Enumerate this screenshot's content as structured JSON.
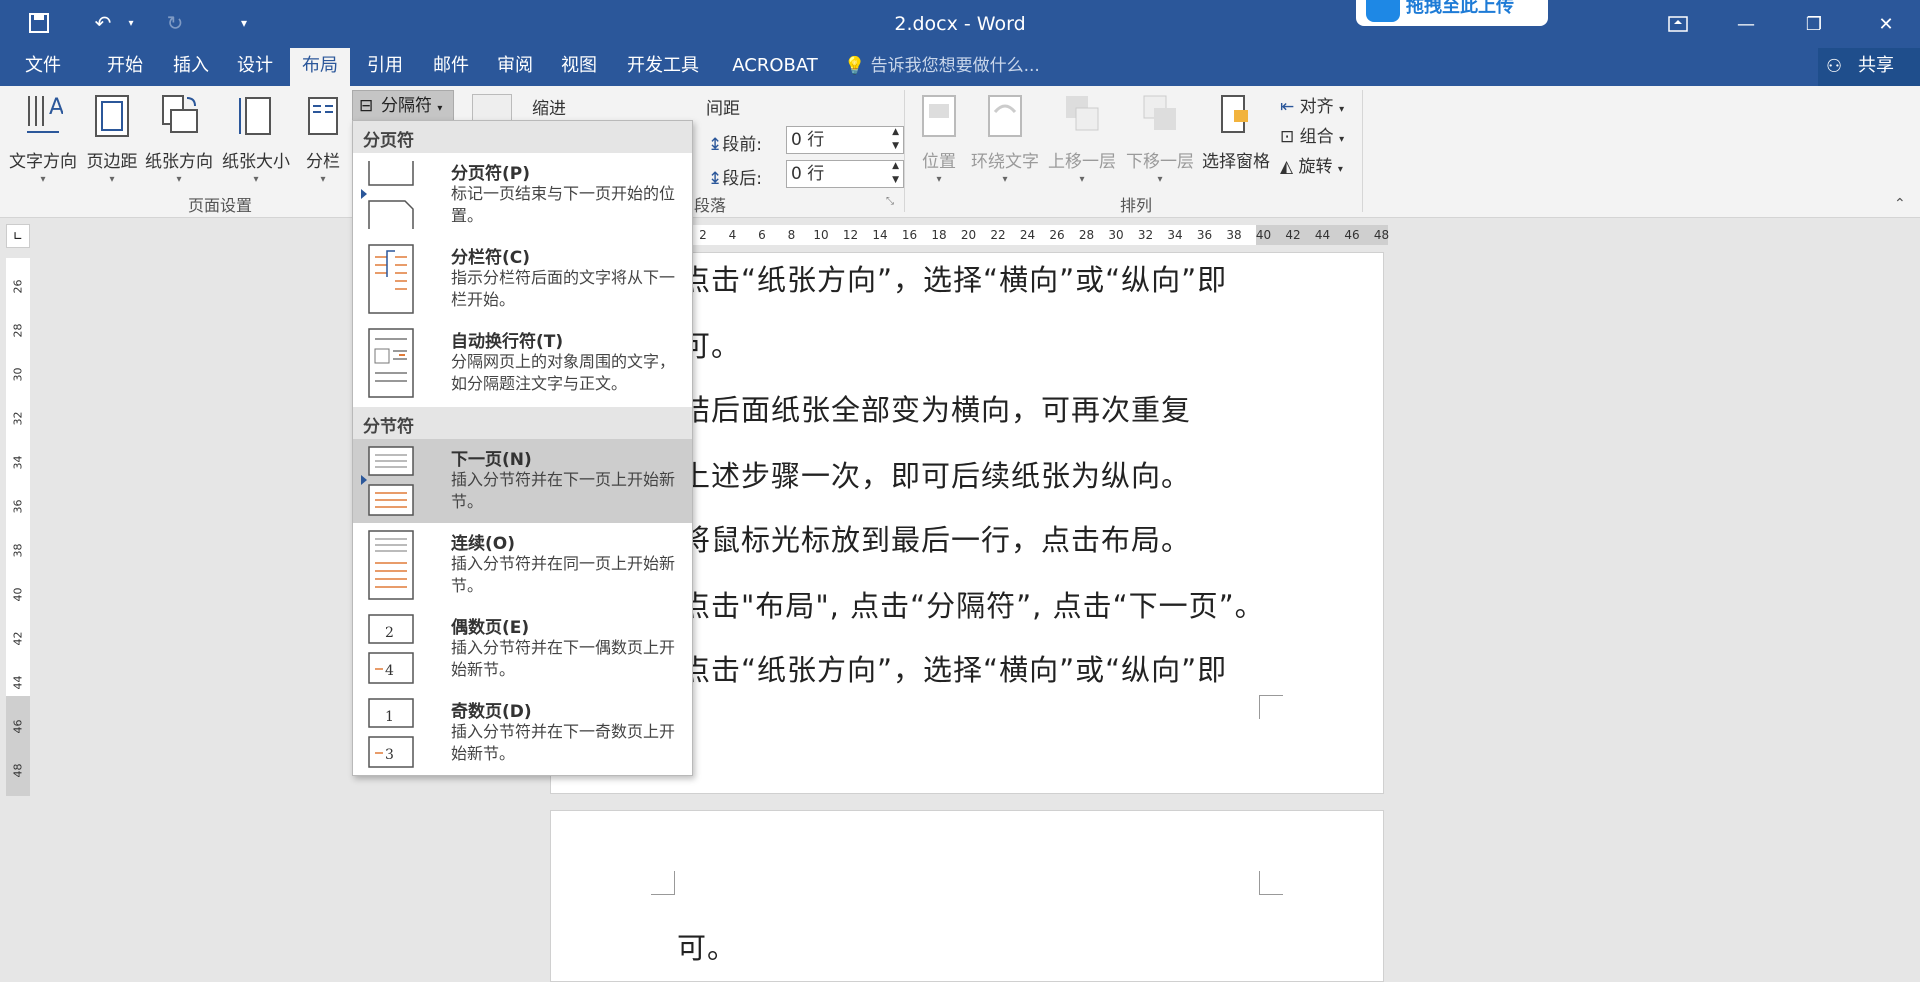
{
  "window": {
    "title": "2.docx - Word",
    "upload_badge": "拖拽至此上传"
  },
  "tabs": [
    "文件",
    "开始",
    "插入",
    "设计",
    "布局",
    "引用",
    "邮件",
    "审阅",
    "视图",
    "开发工具",
    "ACROBAT"
  ],
  "tell_me": "告诉我您想要做什么...",
  "share": "共享",
  "ribbon": {
    "page_setup": {
      "text_direction": "文字方向",
      "margins": "页边距",
      "orientation": "纸张方向",
      "size": "纸张大小",
      "columns": "分栏",
      "breaks": "分隔符",
      "group_label": "页面设置"
    },
    "paragraph": {
      "indent_label": "缩进",
      "spacing_label": "间距",
      "before_label": "段前:",
      "before_value": "0 行",
      "after_label": "段后:",
      "after_value": "0 行",
      "group_label": "段落"
    },
    "arrange": {
      "position": "位置",
      "wrap_text": "环绕文字",
      "bring_forward": "上移一层",
      "send_backward": "下移一层",
      "selection_pane": "选择窗格",
      "align": "对齐",
      "group": "组合",
      "rotate": "旋转",
      "group_label": "排列"
    }
  },
  "ruler_h": [
    "2",
    "4",
    "6",
    "8",
    "10",
    "12",
    "14",
    "16",
    "18",
    "20",
    "22",
    "24",
    "26",
    "28",
    "30",
    "32",
    "34",
    "36",
    "38",
    "40",
    "42",
    "44",
    "46",
    "48"
  ],
  "ruler_v": [
    "26",
    "28",
    "30",
    "32",
    "34",
    "36",
    "38",
    "40",
    "42",
    "44",
    "46",
    "48"
  ],
  "breaks_menu": {
    "section1": "分页符",
    "items1": [
      {
        "title": "分页符(P)",
        "desc": "标记一页结束与下一页开始的位置。"
      },
      {
        "title": "分栏符(C)",
        "desc": "指示分栏符后面的文字将从下一栏开始。"
      },
      {
        "title": "自动换行符(T)",
        "desc": "分隔网页上的对象周围的文字，如分隔题注文字与正文。"
      }
    ],
    "section2": "分节符",
    "items2": [
      {
        "title": "下一页(N)",
        "desc": "插入分节符并在下一页上开始新节。"
      },
      {
        "title": "连续(O)",
        "desc": "插入分节符并在同一页上开始新节。"
      },
      {
        "title": "偶数页(E)",
        "desc": "插入分节符并在下一偶数页上开始新节。"
      },
      {
        "title": "奇数页(D)",
        "desc": "插入分节符并在下一奇数页上开始新节。"
      }
    ]
  },
  "document": {
    "lines": [
      "点击“纸张方向”，选择“横向”或“纵向”即",
      "可。",
      "结后面纸张全部变为横向，可再次重复",
      "上述步骤一次，即可后续纸张为纵向。",
      "将鼠标光标放到最后一行，点击布局。",
      "点击\"布局\", 点击“分隔符”, 点击“下一页”。",
      "点击“纸张方向”，选择“横向”或“纵向”即"
    ],
    "page2_line": "可。"
  }
}
